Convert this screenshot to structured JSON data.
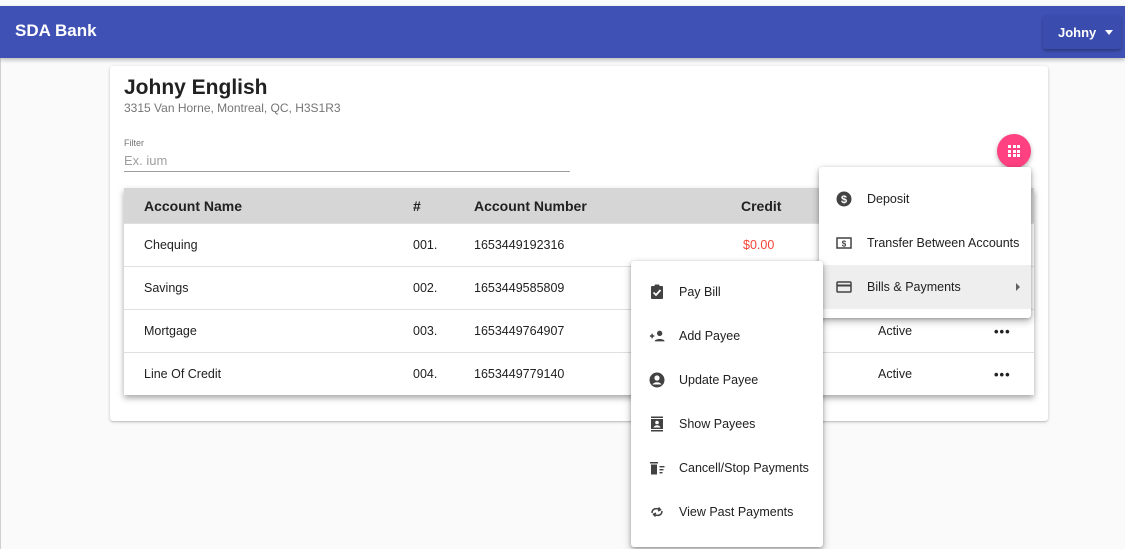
{
  "app": {
    "brand": "SDA Bank",
    "user_menu_label": "Johny"
  },
  "customer": {
    "name": "Johny English",
    "address": "3315 Van Horne, Montreal, QC, H3S1R3"
  },
  "filter": {
    "label": "Filter",
    "placeholder": "Ex. ium",
    "value": ""
  },
  "table": {
    "headers": {
      "account_name": "Account Name",
      "number": "#",
      "account_number": "Account Number",
      "credit": "Credit"
    },
    "rows": [
      {
        "name": "Chequing",
        "num": "001.",
        "account_number": "1653449192316",
        "credit": "$0.00",
        "status": ""
      },
      {
        "name": "Savings",
        "num": "002.",
        "account_number": "1653449585809",
        "credit": "",
        "status": ""
      },
      {
        "name": "Mortgage",
        "num": "003.",
        "account_number": "1653449764907",
        "credit": "",
        "status": "Active"
      },
      {
        "name": "Line Of Credit",
        "num": "004.",
        "account_number": "1653449779140",
        "credit": "",
        "status": "Active"
      }
    ],
    "more_label": "•••"
  },
  "actions_menu": {
    "items": [
      {
        "label": "Deposit",
        "icon": "dollar-circle-icon"
      },
      {
        "label": "Transfer Between Accounts",
        "icon": "bill-icon"
      },
      {
        "label": "Bills & Payments",
        "icon": "credit-card-icon"
      }
    ]
  },
  "bills_submenu": {
    "items": [
      {
        "label": "Pay Bill",
        "icon": "clipboard-check-icon"
      },
      {
        "label": "Add Payee",
        "icon": "person-add-icon"
      },
      {
        "label": "Update Payee",
        "icon": "account-circle-icon"
      },
      {
        "label": "Show Payees",
        "icon": "contacts-icon"
      },
      {
        "label": "Cancell/Stop Payments",
        "icon": "delete-sweep-icon"
      },
      {
        "label": "View Past Payments",
        "icon": "refresh-icon"
      }
    ]
  },
  "colors": {
    "primary": "#3f51b5",
    "accent": "#ff4081",
    "credit_negative": "#f44336"
  }
}
